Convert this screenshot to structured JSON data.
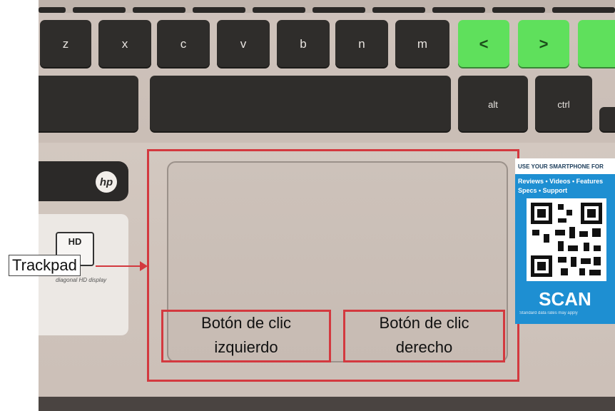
{
  "keys": {
    "row_bottom_letters": [
      "z",
      "x",
      "c",
      "v",
      "b",
      "n",
      "m"
    ],
    "green_keys": [
      "<",
      ">",
      ""
    ],
    "modifiers": {
      "alt": "alt",
      "ctrl": "ctrl"
    }
  },
  "device": {
    "brand": "hp",
    "hd_badge": "HD",
    "hd_caption": "diagonal HD display"
  },
  "callout": {
    "label": "Trackpad"
  },
  "trackpad": {
    "left_button_label_line1": "Botón de clic",
    "left_button_label_line2": "izquierdo",
    "right_button_label_line1": "Botón de clic",
    "right_button_label_line2": "derecho"
  },
  "qr_sticker": {
    "header": "USE YOUR SMARTPHONE FOR",
    "subline1": "Reviews • Videos • Features",
    "subline2": "Specs • Support",
    "scan": "SCAN",
    "footer": "Standard data rates may apply"
  },
  "colors": {
    "highlight_red": "#d3393f",
    "key_green": "#5fe05c",
    "sticker_blue": "#1e8fd2"
  }
}
